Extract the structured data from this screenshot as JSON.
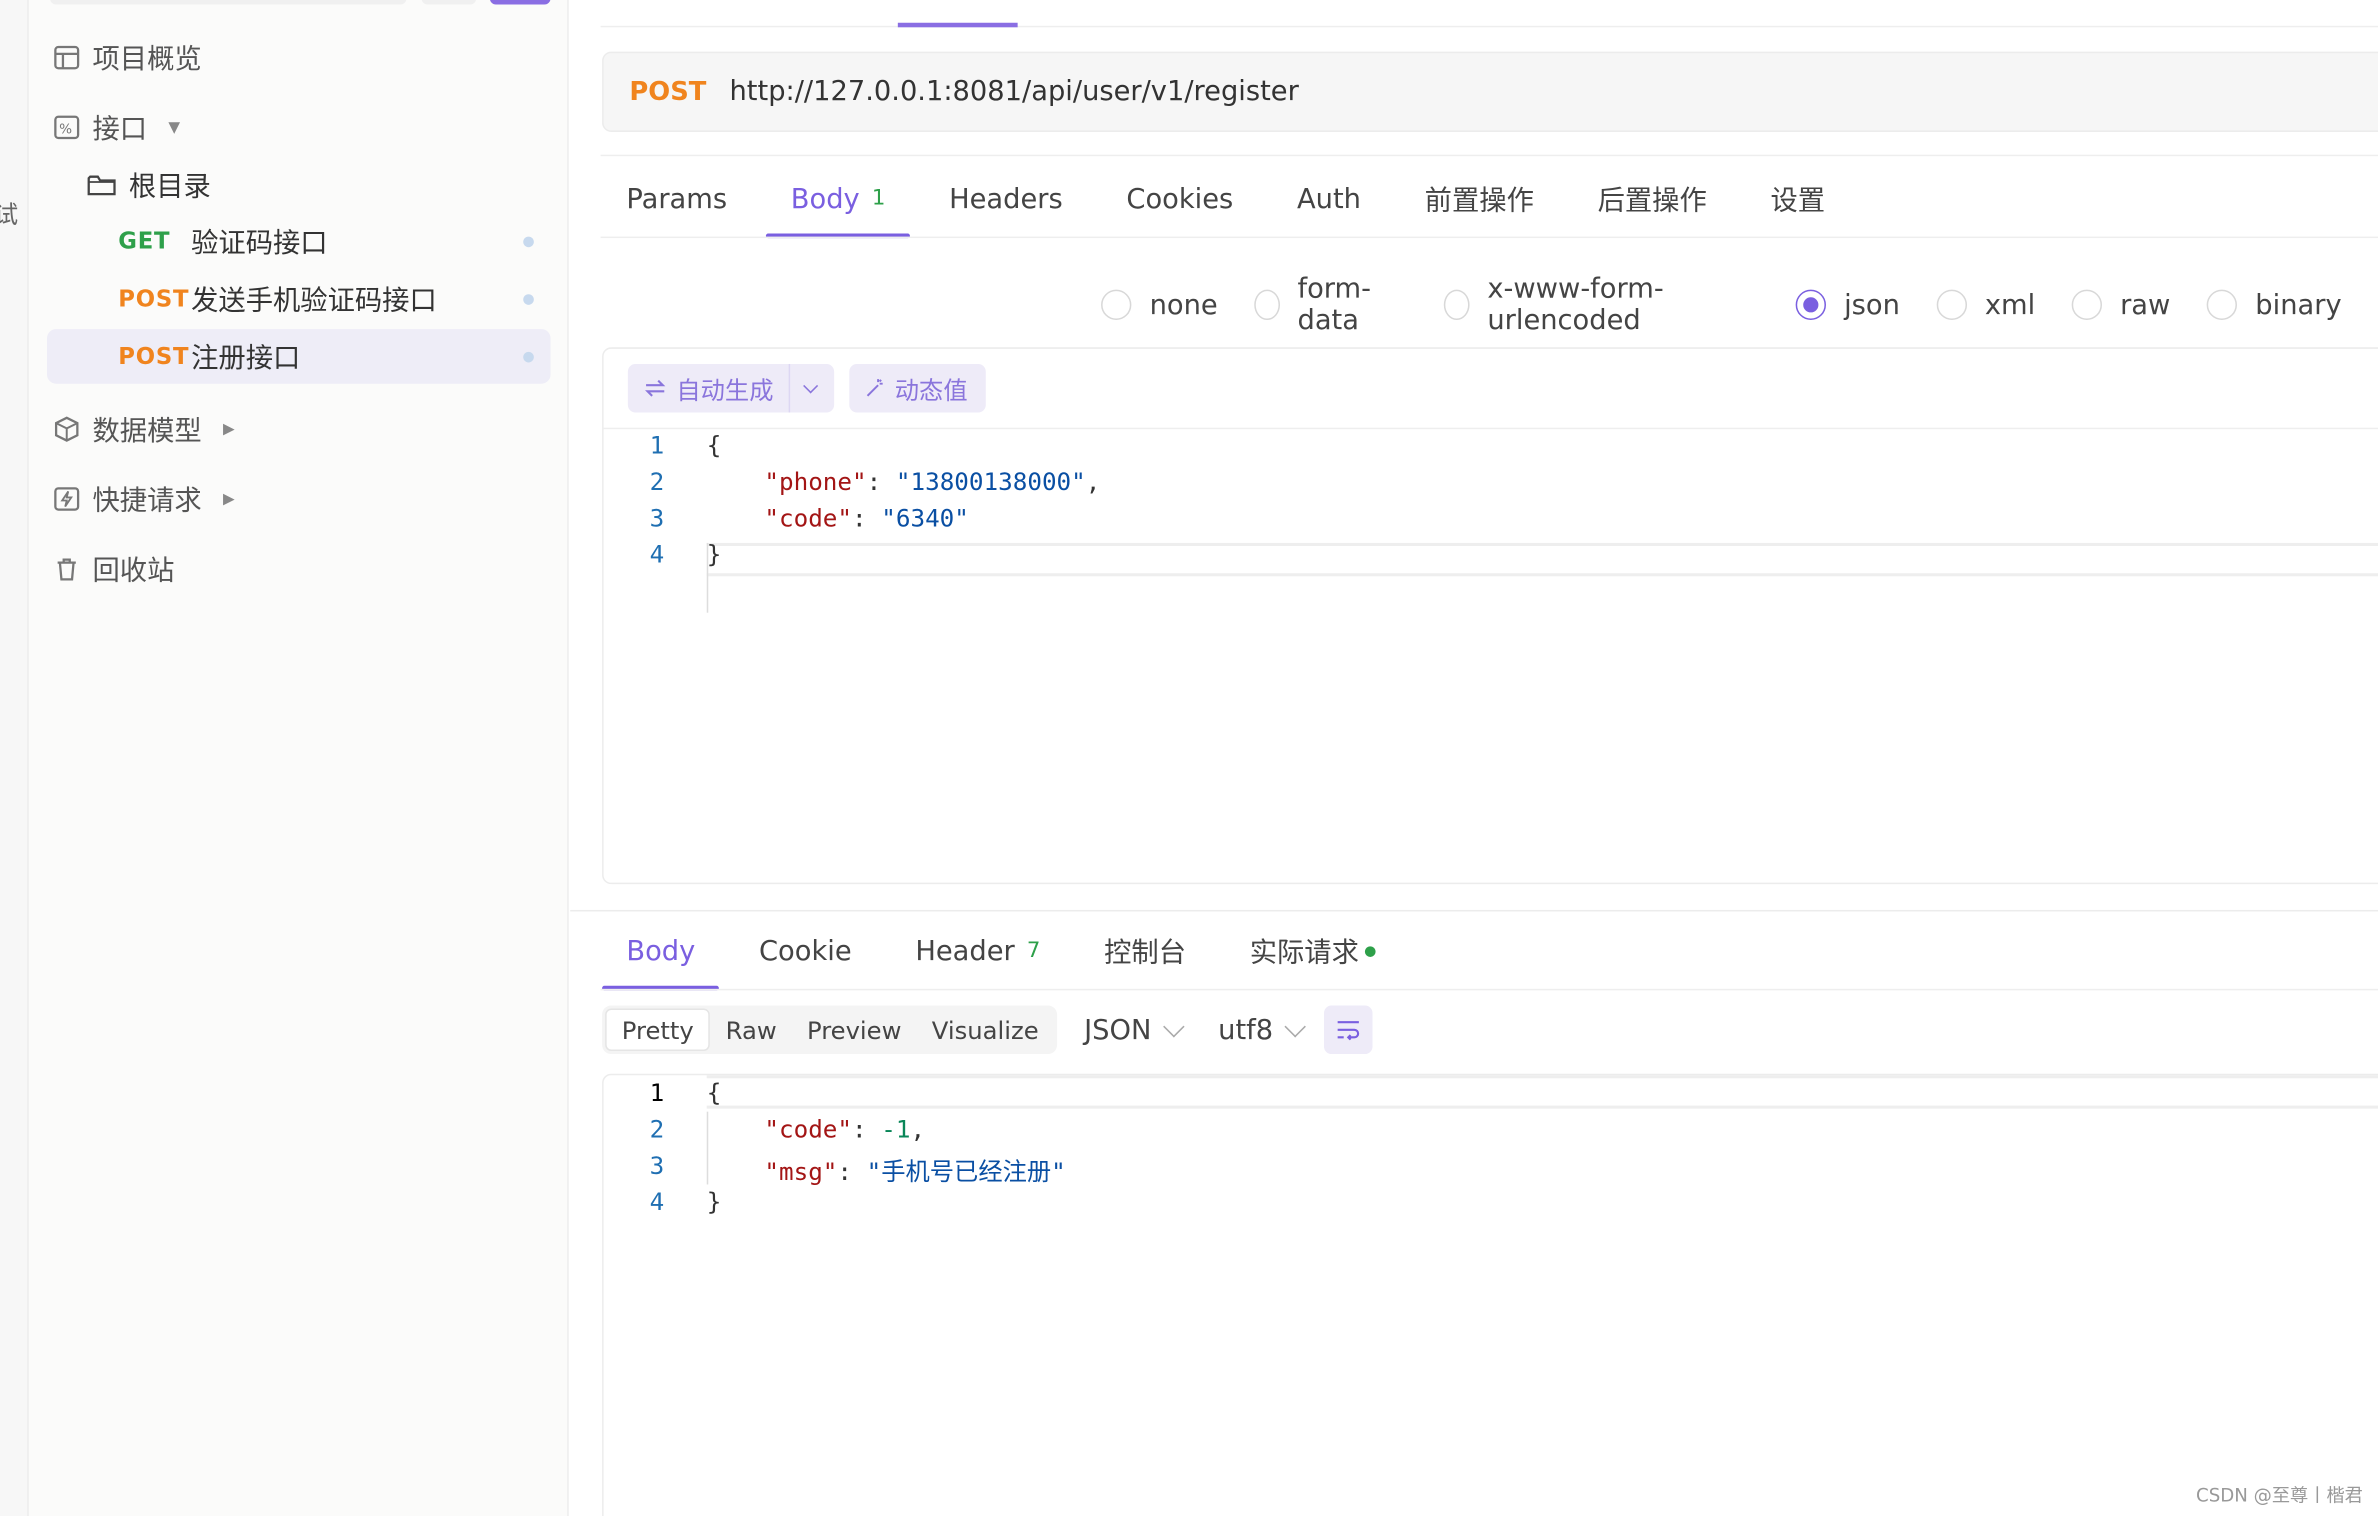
{
  "left_strip": {
    "glyph": "试"
  },
  "sidebar": {
    "items": [
      {
        "label": "项目概览",
        "icon": "layout-icon"
      },
      {
        "label": "接口",
        "icon": "api-icon"
      },
      {
        "label": "数据模型",
        "icon": "cube-icon"
      },
      {
        "label": "快捷请求",
        "icon": "bolt-icon"
      },
      {
        "label": "回收站",
        "icon": "trash-icon"
      }
    ],
    "folder": {
      "label": "根目录",
      "icon": "folder-icon"
    },
    "endpoints": [
      {
        "method": "GET",
        "name": "验证码接口",
        "color": "#2ea04a"
      },
      {
        "method": "POST",
        "name": "发送手机验证码接口",
        "color": "#f0841e"
      },
      {
        "method": "POST",
        "name": "注册接口",
        "color": "#f0841e",
        "selected": true
      }
    ]
  },
  "request": {
    "method": "POST",
    "url": "http://127.0.0.1:8081/api/user/v1/register",
    "tabs": [
      {
        "label": "Params"
      },
      {
        "label": "Body",
        "badge": "1",
        "active": true
      },
      {
        "label": "Headers"
      },
      {
        "label": "Cookies"
      },
      {
        "label": "Auth"
      },
      {
        "label": "前置操作"
      },
      {
        "label": "后置操作"
      },
      {
        "label": "设置"
      }
    ],
    "body_types": [
      "none",
      "form-data",
      "x-www-form-urlencoded",
      "json",
      "xml",
      "raw",
      "binary"
    ],
    "selected_body_type": "json",
    "tool_auto": "自动生成",
    "tool_dynamic": "动态值",
    "body_lines": [
      {
        "n": "1",
        "text": "{"
      },
      {
        "n": "2",
        "key": "\"phone\"",
        "value": "\"13800138000\"",
        "trail": ","
      },
      {
        "n": "3",
        "key": "\"code\"",
        "value": "\"6340\"",
        "trail": ""
      },
      {
        "n": "4",
        "text": "}"
      }
    ]
  },
  "response": {
    "tabs": [
      {
        "label": "Body",
        "active": true
      },
      {
        "label": "Cookie"
      },
      {
        "label": "Header",
        "badge": "7"
      },
      {
        "label": "控制台"
      },
      {
        "label": "实际请求",
        "dot": true
      }
    ],
    "view_modes": [
      "Pretty",
      "Raw",
      "Preview",
      "Visualize"
    ],
    "selected_view": "Pretty",
    "format": "JSON",
    "encoding": "utf8",
    "body_lines": [
      {
        "n": "1",
        "text": "{"
      },
      {
        "n": "2",
        "key": "\"code\"",
        "value": "-1",
        "trail": ",",
        "numeric": true
      },
      {
        "n": "3",
        "key": "\"msg\"",
        "value": "\"手机号已经注册\"",
        "trail": ""
      },
      {
        "n": "4",
        "text": "}"
      }
    ]
  },
  "footer": {
    "watermark": "CSDN @至尊丨楷君"
  },
  "colors": {
    "accent": "#7a5fe0",
    "post": "#f0841e",
    "get": "#2ea04a"
  }
}
